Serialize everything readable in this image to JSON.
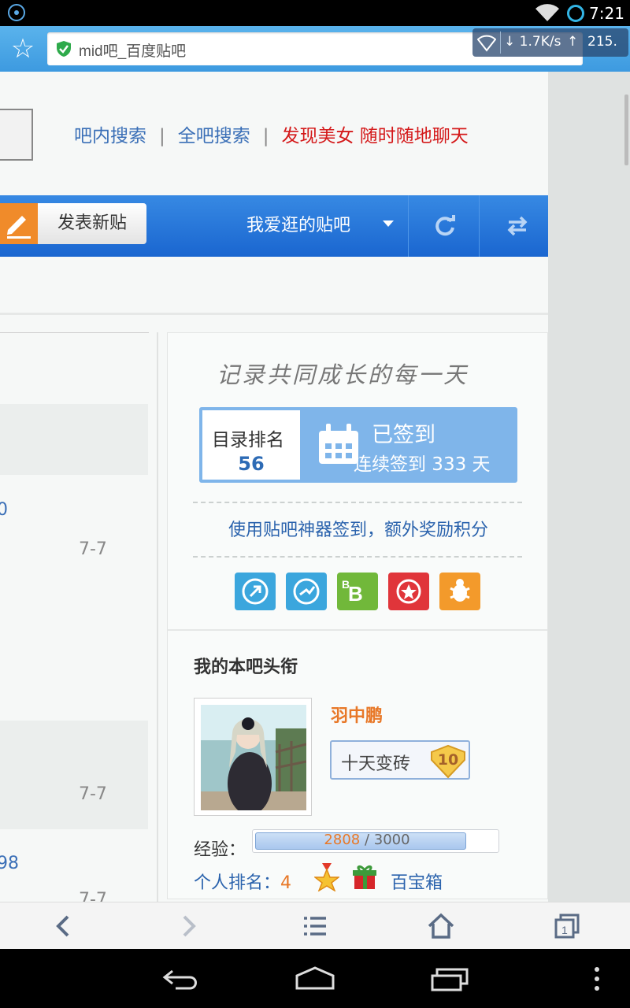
{
  "status_bar": {
    "time": "7:21",
    "icons": [
      "app-notification-icon",
      "wifi-icon",
      "sync-icon"
    ]
  },
  "browser": {
    "url_text": "mid吧_百度贴吧",
    "net_speed": {
      "down": "1.7K/s",
      "up_value": "215."
    }
  },
  "header_links": {
    "search_in_bar": "吧内搜索",
    "search_all": "全吧搜索",
    "promo": "发现美女 随时随地聊天",
    "separator": "|"
  },
  "toolbar": {
    "post_button": "发表新贴",
    "favorites_label": "我爱逛的贴吧"
  },
  "left_list": {
    "number1": "0",
    "date1": "7-7",
    "date2": "7-7",
    "number2": "98",
    "date3": "7-7"
  },
  "sign_panel": {
    "motto": "记录共同成长的每一天",
    "rank_label": "目录排名",
    "rank_value": "56",
    "signed_label": "已签到",
    "streak_text": "连续签到 333 天",
    "bonus_link": "使用贴吧神器签到，额外奖励积分",
    "tools": [
      "tool-icon-1",
      "tool-icon-2",
      "tool-icon-b",
      "tool-icon-star",
      "tool-icon-bug"
    ]
  },
  "profile": {
    "section_title": "我的本吧头衔",
    "username": "羽中鹏",
    "rank_title": "十天变砖",
    "level": "10",
    "exp_label": "经验：",
    "exp_current": "2808",
    "exp_total": "/ 3000",
    "exp_progress": 0.936,
    "personal_rank_label": "个人排名：",
    "personal_rank_value": "4",
    "treasure_label": "百宝箱"
  },
  "colors": {
    "accent_blue": "#1a66d0",
    "link_blue": "#3a6fb7",
    "promo_red": "#d4191a",
    "orange": "#e87828"
  }
}
